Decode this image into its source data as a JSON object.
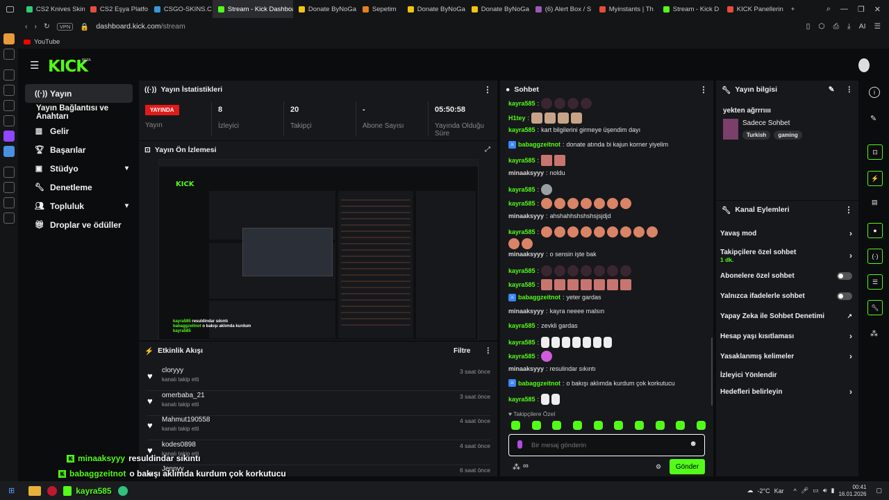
{
  "tabs": [
    {
      "label": "CS2 Knives Skin",
      "color": "#2ecc71"
    },
    {
      "label": "CS2 Eşya Platfo",
      "color": "#e74c3c"
    },
    {
      "label": "CSGO-SKINS.C",
      "color": "#3498db"
    },
    {
      "label": "Stream - Kick Dashboard",
      "color": "#53fc18"
    },
    {
      "label": "Donate ByNoGa",
      "color": "#f1c40f"
    },
    {
      "label": "Sepetim",
      "color": "#e67e22"
    },
    {
      "label": "Donate ByNoGa",
      "color": "#f1c40f"
    },
    {
      "label": "Donate ByNoGa",
      "color": "#f1c40f"
    },
    {
      "label": "(6) Alert Box / S",
      "color": "#9b59b6"
    },
    {
      "label": "Myinstants | Th",
      "color": "#e74c3c"
    },
    {
      "label": "Stream - Kick D",
      "color": "#53fc18"
    },
    {
      "label": "KICK Panellerin",
      "color": "#e74c3c"
    }
  ],
  "url": {
    "vpn": "VPN",
    "host": "dashboard.kick.com",
    "path": "/stream"
  },
  "bookmarks": [
    "YouTube"
  ],
  "brand": {
    "logo": "KICK",
    "beta": "BETA"
  },
  "sidebar": [
    {
      "label": "Yayın",
      "icon": "broadcast-icon"
    },
    {
      "label": "Yayın Bağlantısı ve Anahtarı"
    },
    {
      "label": "Gelir",
      "icon": "chart-icon"
    },
    {
      "label": "Başarılar",
      "icon": "trophy-icon"
    },
    {
      "label": "Stüdyo",
      "icon": "studio-icon"
    },
    {
      "label": "Denetleme",
      "icon": "wrench-icon"
    },
    {
      "label": "Topluluk",
      "icon": "people-icon"
    },
    {
      "label": "Droplar ve ödüller",
      "icon": "gift-icon"
    }
  ],
  "stats": {
    "title": "Yayın İstatistikleri",
    "live_badge": "YAYINDA",
    "live_label": "Yayın",
    "viewers": "8",
    "viewers_label": "İzleyici",
    "followers": "20",
    "followers_label": "Takipçi",
    "subs": "-",
    "subs_label": "Abone Sayısı",
    "uptime": "05:50:58",
    "uptime_label": "Yayında Olduğu Süre"
  },
  "preview": {
    "title": "Yayın Ön İzlemesi"
  },
  "activity": {
    "title": "Etkinlik Akışı",
    "filter": "Filtre",
    "rows": [
      {
        "name": "cloryyy",
        "sub": "kanalı takip etti",
        "time": "3 saat önce"
      },
      {
        "name": "omerbaba_21",
        "sub": "kanalı takip etti",
        "time": "3 saat önce"
      },
      {
        "name": "Mahmut190558",
        "sub": "kanalı takip etti",
        "time": "4 saat önce"
      },
      {
        "name": "kodes0898",
        "sub": "kanalı takip etti",
        "time": "4 saat önce"
      },
      {
        "name": "Jennyy",
        "sub": "",
        "time": "6 saat önce"
      }
    ]
  },
  "chat": {
    "title": "Sohbet",
    "messages": [
      {
        "user": "kayra585",
        "text": "",
        "emotes": 4,
        "kind": "dk"
      },
      {
        "user": "H1tey",
        "text": "",
        "emotes": 4,
        "kind": "cat"
      },
      {
        "user": "kayra585",
        "text": "kart bilgilerini girmeye üşendim dayı"
      },
      {
        "user": "babaggzeitnot",
        "mod": true,
        "text": "donate atında bi kajun korner yiyelim"
      },
      {
        "user": "kayra585",
        "text": "",
        "emotes": 2,
        "kind": "fc"
      },
      {
        "user": "minaaksyyy",
        "white": true,
        "text": "noldu"
      },
      {
        "user": "kayra585",
        "text": "",
        "emotes": 1,
        "kind": "gr"
      },
      {
        "user": "kayra585",
        "text": "",
        "emotes": 7,
        "kind": ""
      },
      {
        "user": "minaaksyyy",
        "white": true,
        "text": "ahshahhshshshsjsjdjd"
      },
      {
        "user": "kayra585",
        "text": "",
        "emotes": 11,
        "kind": "",
        "wrap": 2
      },
      {
        "user": "minaaksyyy",
        "white": true,
        "text": "o sensin işte bak"
      },
      {
        "user": "kayra585",
        "text": "",
        "emotes": 7,
        "kind": "dk"
      },
      {
        "user": "kayra585",
        "text": "",
        "emotes": 7,
        "kind": "fc"
      },
      {
        "user": "babaggzeitnot",
        "mod": true,
        "text": "yeter gardas"
      },
      {
        "user": "minaaksyyy",
        "white": true,
        "text": "kayra neeee malsın"
      },
      {
        "user": "kayra585",
        "text": "zevkli gardas"
      },
      {
        "user": "kayra585",
        "text": "",
        "emotes": 7,
        "kind": "wh"
      },
      {
        "user": "kayra585",
        "text": "",
        "emotes": 1,
        "kind": "pk"
      },
      {
        "user": "minaaksyyy",
        "white": true,
        "text": "resulindar sıkıntı"
      },
      {
        "user": "babaggzeitnot",
        "mod": true,
        "text": "o bakışı aklımda kurdum çok korkutucu"
      },
      {
        "user": "kayra585",
        "text": "",
        "emotes": 2,
        "kind": "wh"
      }
    ],
    "followers_only": "Takipçilere Özel",
    "placeholder": "Bir mesaj gönderin",
    "send": "Gönder"
  },
  "info": {
    "title": "Yayın bilgisi",
    "stream_title": "yekten ağrrrıııı",
    "category": "Sadece Sohbet",
    "tags": [
      "Turkish",
      "gaming"
    ]
  },
  "channel_actions": {
    "title": "Kanal Eylemleri",
    "items": [
      {
        "label": "Yavaş mod",
        "type": "arrow"
      },
      {
        "label": "Takipçilere özel sohbet",
        "sub": "1 dk.",
        "type": "arrow"
      },
      {
        "label": "Abonelere özel sohbet",
        "type": "toggle"
      },
      {
        "label": "Yalnızca ifadelerle sohbet",
        "type": "toggle"
      },
      {
        "label": "Yapay Zeka ile Sohbet Denetimi",
        "type": "ext"
      },
      {
        "label": "Hesap yaşı kısıtlaması",
        "type": "arrow"
      },
      {
        "label": "Yasaklanmış kelimeler",
        "type": "arrow"
      },
      {
        "label": "İzleyici Yönlendir",
        "type": "none"
      },
      {
        "label": "Hedefleri belirleyin",
        "type": "arrow"
      }
    ]
  },
  "overlay": [
    {
      "user": "minaaksyyy",
      "text": "resuldindar sıkıntı"
    },
    {
      "user": "babaggzeitnot",
      "text": "o bakışı aklımda kurdum çok korkutucu"
    },
    {
      "user": "kayra585",
      "text": ""
    }
  ],
  "taskbar": {
    "weather": "-2°C",
    "weather_desc": "Kar",
    "time": "00:41",
    "date": "16.01.2026"
  }
}
